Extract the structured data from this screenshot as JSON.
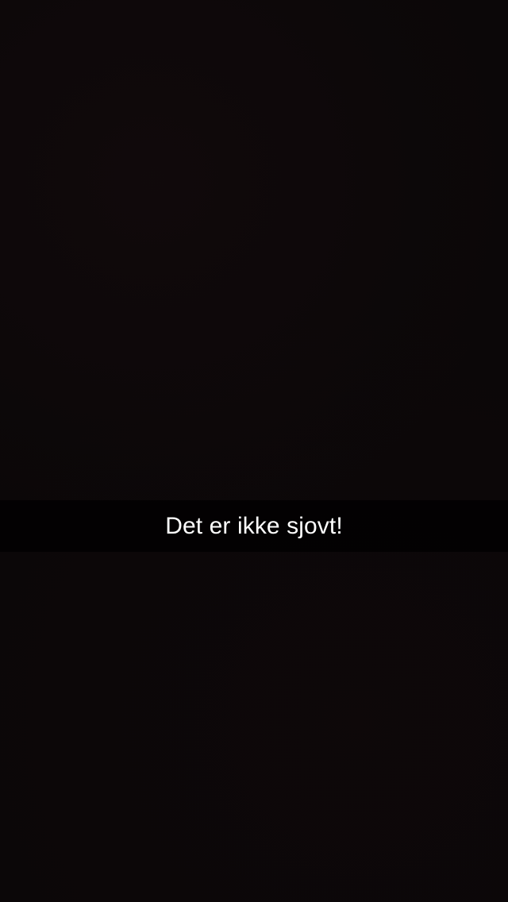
{
  "caption": {
    "text": "Det er ikke sjovt!"
  },
  "colors": {
    "background": "#0b0708",
    "caption_bar": "#000000",
    "caption_text": "#ffffff"
  }
}
